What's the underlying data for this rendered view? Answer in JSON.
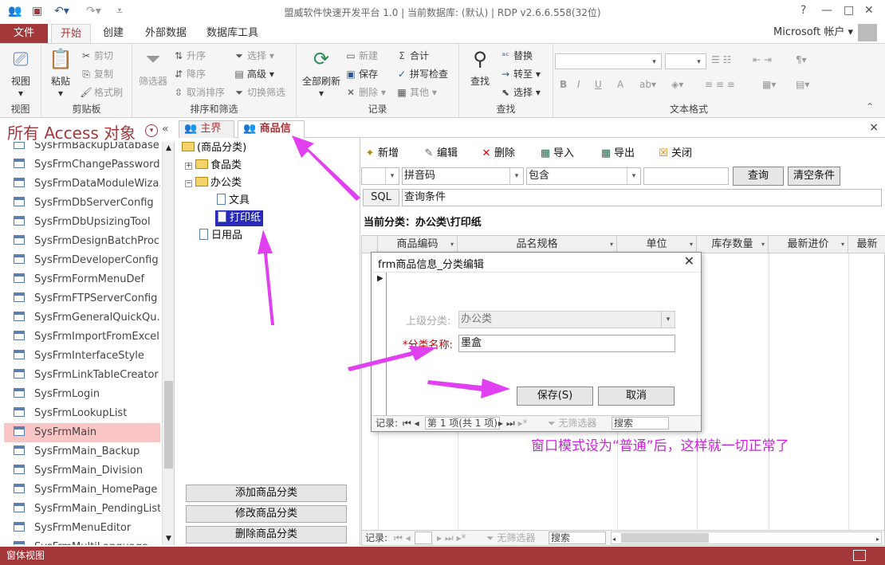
{
  "window": {
    "title": "盟威软件快速开发平台 1.0 | 当前数据库: (默认) | RDP v2.6.6.558(32位)",
    "help": "?",
    "min": "—",
    "max": "□",
    "close": "✕"
  },
  "ribbon_tabs": {
    "file": "文件",
    "home": "开始",
    "create": "创建",
    "external": "外部数据",
    "dbtools": "数据库工具",
    "account": "Microsoft 帐户"
  },
  "ribbon": {
    "view_group": {
      "label": "记录",
      "view": "视图",
      "group_name": "视图"
    },
    "clipboard": {
      "label": "剪贴板",
      "paste": "粘贴",
      "cut": "剪切",
      "copy": "复制",
      "format_painter": "格式刷"
    },
    "sort_filter": {
      "label": "排序和筛选",
      "filter": "筛选器",
      "asc": "升序",
      "desc": "降序",
      "remove_sort": "取消排序",
      "select": "选择",
      "advanced": "高级",
      "toggle": "切换筛选"
    },
    "records": {
      "label": "记录",
      "refresh": "全部刷新",
      "new": "新建",
      "save": "保存",
      "delete": "删除",
      "totals": "合计",
      "spell": "拼写检查",
      "more": "其他"
    },
    "find": {
      "label": "查找",
      "find": "查找",
      "replace": "替换",
      "goto": "转至",
      "select": "选择"
    },
    "text_format": {
      "label": "文本格式",
      "bold": "B",
      "italic": "I",
      "underline": "U",
      "font_color": "A"
    }
  },
  "nav": {
    "title": "所有 Access 对象",
    "items": [
      "SysFrmBackupDatabase",
      "SysFrmChangePassword",
      "SysFrmDataModuleWiza...",
      "SysFrmDbServerConfig",
      "SysFrmDbUpsizingTool",
      "SysFrmDesignBatchProc...",
      "SysFrmDeveloperConfig",
      "SysFrmFormMenuDef",
      "SysFrmFTPServerConfig",
      "SysFrmGeneralQuickQu...",
      "SysFrmImportFromExcel",
      "SysFrmInterfaceStyle",
      "SysFrmLinkTableCreator",
      "SysFrmLogin",
      "SysFrmLookupList",
      "SysFrmMain",
      "SysFrmMain_Backup",
      "SysFrmMain_Division",
      "SysFrmMain_HomePage",
      "SysFrmMain_PendingList",
      "SysFrmMenuEditor",
      "SysFrmMultiLanguage"
    ],
    "selected": "SysFrmMain"
  },
  "doc_tabs": {
    "main": "主界面",
    "product": "商品信息",
    "close": "×"
  },
  "tree": {
    "root": "(商品分类)",
    "food": "食品类",
    "office": "办公类",
    "stationery": "文具",
    "paper": "打印纸",
    "daily": "日用品",
    "btn_add": "添加商品分类",
    "btn_edit": "修改商品分类",
    "btn_delete": "删除商品分类"
  },
  "toolbar": {
    "new": "新增",
    "edit": "编辑",
    "delete": "删除",
    "import": "导入",
    "export": "导出",
    "close": "关闭"
  },
  "query": {
    "field": "拼音码",
    "op": "包含",
    "value": "",
    "search_btn": "查询",
    "clear_btn": "清空条件",
    "sql_label": "SQL",
    "sql_text": "查询条件",
    "current_category": "当前分类：办公类\\打印纸"
  },
  "grid": {
    "columns": [
      "商品编码",
      "品名规格",
      "单位",
      "库存数量",
      "最新进价",
      "最新"
    ],
    "record_label": "记录:",
    "no_filter": "无筛选器",
    "search": "搜索"
  },
  "dialog": {
    "title": "frm商品信息_分类编辑",
    "parent_label": "上级分类:",
    "parent_value": "办公类",
    "name_label": "*分类名称:",
    "name_value": "墨盒",
    "save_btn": "保存(S)",
    "cancel_btn": "取消",
    "record_label": "记录:",
    "record_pos": "第 1 项(共 1 项)",
    "no_filter": "无筛选器",
    "search": "搜索"
  },
  "annotation": "窗口模式设为“普通”后，这样就一切正常了",
  "status": {
    "text": "窗体视图"
  },
  "colors": {
    "accent": "#a4373a",
    "annotation": "#d020e0",
    "selected_nav": "#f9c5c5",
    "tree_selected": "#2a2ab8"
  }
}
